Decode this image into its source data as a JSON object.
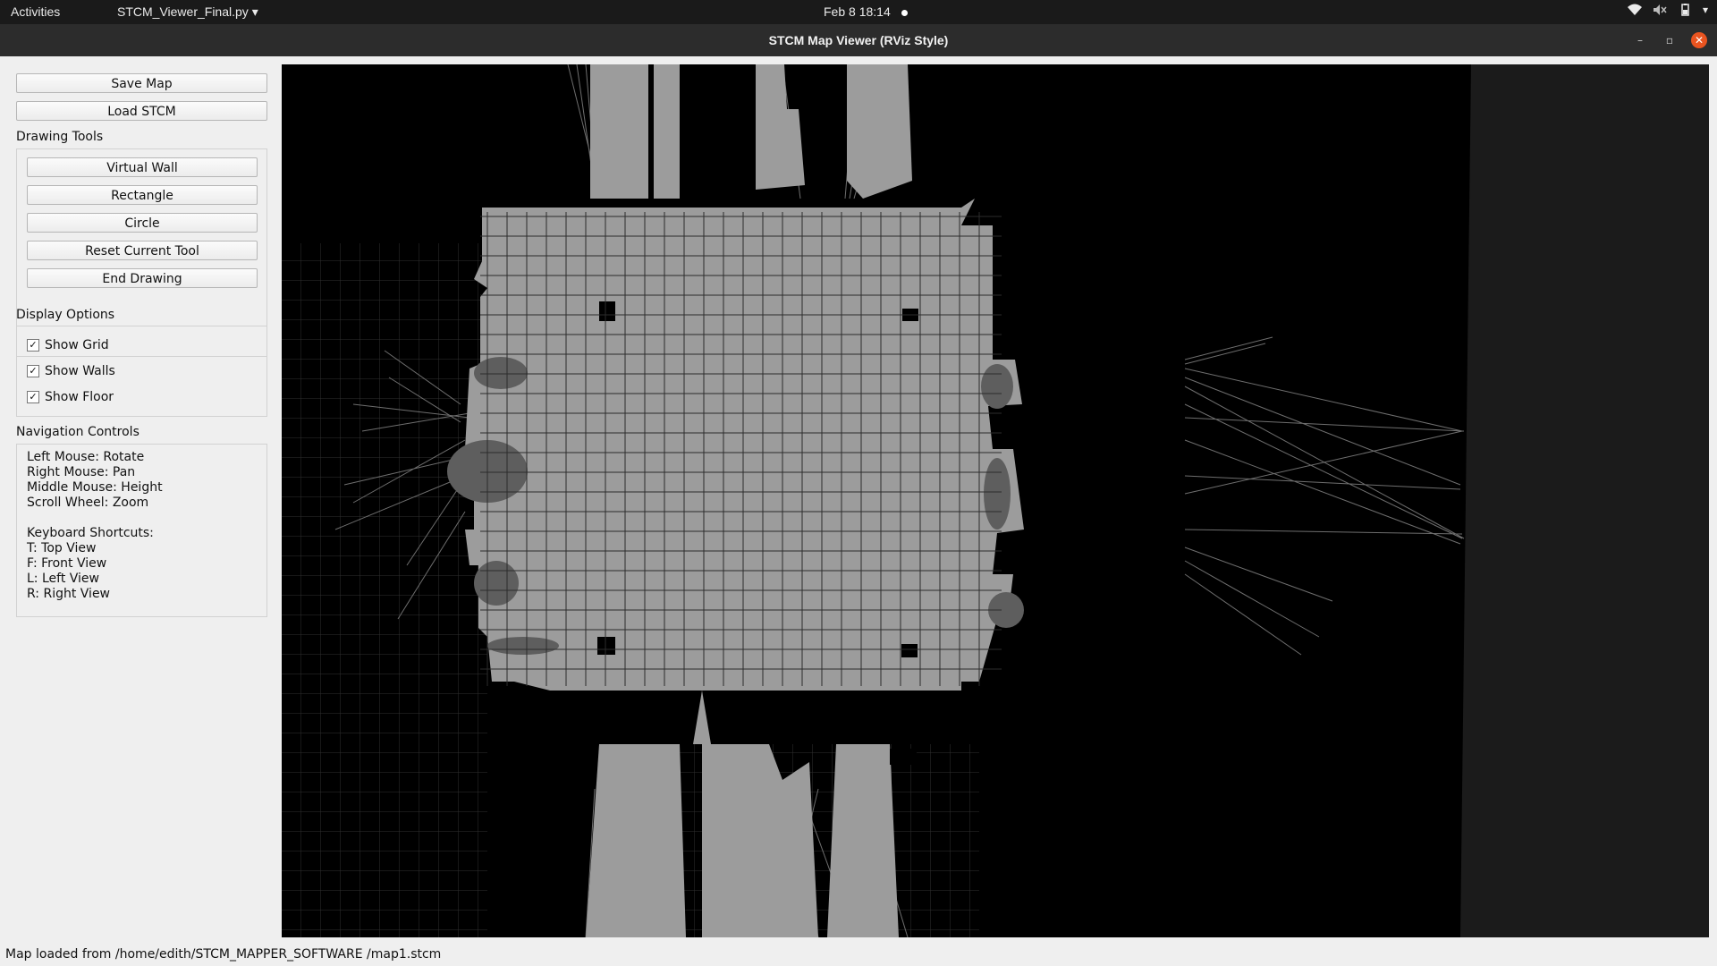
{
  "topbar": {
    "activities": "Activities",
    "app_menu": "STCM_Viewer_Final.py",
    "clock": "Feb 8  18:14"
  },
  "window": {
    "title": "STCM Map Viewer (RViz Style)"
  },
  "panel": {
    "save_map": "Save Map",
    "load_stcm": "Load STCM",
    "drawing_tools_label": "Drawing Tools",
    "tools": [
      "Virtual Wall",
      "Rectangle",
      "Circle",
      "Reset Current Tool",
      "End Drawing"
    ],
    "display_options_label": "Display Options",
    "display_options": [
      {
        "label": "Show Grid",
        "checked": true
      },
      {
        "label": "Show Walls",
        "checked": true
      },
      {
        "label": "Show Floor",
        "checked": true
      }
    ],
    "navigation_label": "Navigation Controls",
    "navigation_text": "Left Mouse: Rotate\nRight Mouse: Pan\nMiddle Mouse: Height\nScroll Wheel: Zoom\n\nKeyboard Shortcuts:\nT: Top View\nF: Front View\nL: Left View\nR: Right View"
  },
  "status": {
    "message": "Map loaded from /home/edith/STCM_MAPPER_SOFTWARE /map1.stcm"
  },
  "colors": {
    "floor": "#9c9c9c",
    "grid": "#2a2a2a",
    "background": "#000000",
    "accent_close": "#e95420"
  }
}
